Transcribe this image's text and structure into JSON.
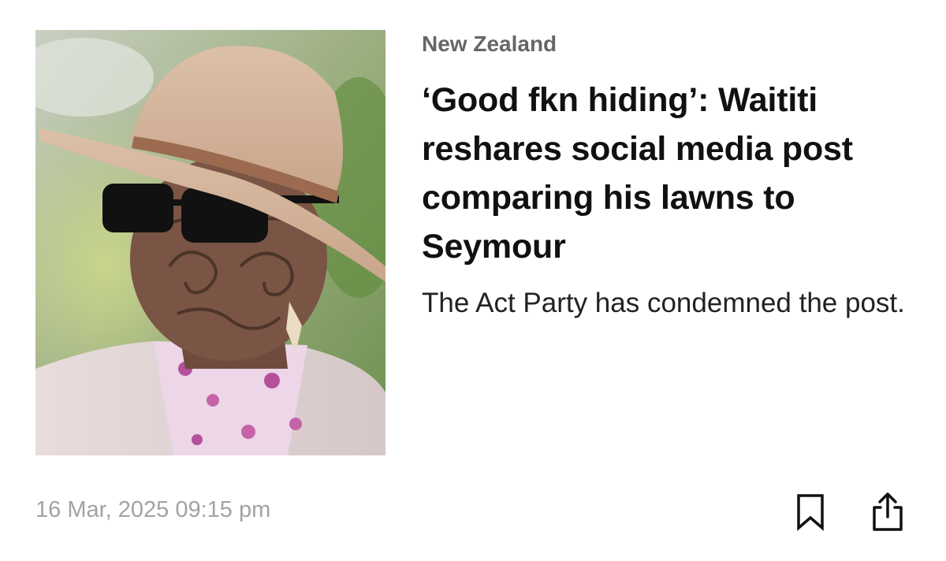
{
  "article": {
    "category": "New Zealand",
    "headline": "‘Good fkn hiding’: Waititi reshares social media post comparing his lawns to Seymour",
    "summary": "The Act Party has condemned the post.",
    "timestamp": "16 Mar, 2025 09:15 pm",
    "image_alt": "Man wearing a wide-brimmed hat and dark sunglasses"
  },
  "actions": {
    "bookmark_icon": "bookmark-icon",
    "share_icon": "share-icon"
  },
  "colors": {
    "category": "#666666",
    "headline": "#111111",
    "timestamp": "#a3a3a3",
    "icon": "#111111"
  }
}
